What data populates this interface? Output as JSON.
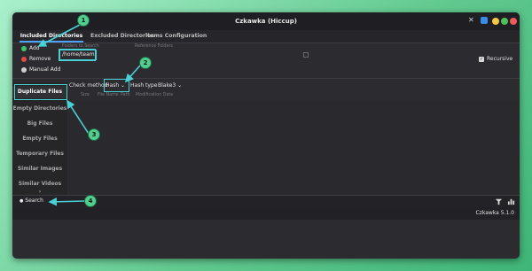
{
  "window": {
    "title": "Czkawka (Hiccup)"
  },
  "tabs": [
    {
      "label": "Included Directories",
      "active": true
    },
    {
      "label": "Excluded Directories",
      "active": false
    },
    {
      "label": "Items Configuration",
      "active": false
    }
  ],
  "included": {
    "actions": [
      {
        "label": "Add",
        "icon": "plus-icon",
        "color": "#3cc46b"
      },
      {
        "label": "Remove",
        "icon": "remove-icon",
        "color": "#e04a4a"
      },
      {
        "label": "Manual Add",
        "icon": "manual-add-icon",
        "color": "#cfcfcf"
      }
    ],
    "columns": {
      "folders": "Folders to Search",
      "reference": "Reference Folders"
    },
    "path": "/home/team",
    "recursive": {
      "label": "Recursive",
      "checked": true
    }
  },
  "sidebar": {
    "items": [
      {
        "label": "Duplicate Files",
        "active": true
      },
      {
        "label": "Empty Directories",
        "active": false
      },
      {
        "label": "Big Files",
        "active": false
      },
      {
        "label": "Empty Files",
        "active": false
      },
      {
        "label": "Temporary Files",
        "active": false
      },
      {
        "label": "Similar Images",
        "active": false
      },
      {
        "label": "Similar Videos",
        "active": false
      }
    ],
    "more": "›"
  },
  "options": {
    "check_method_label": "Check method",
    "check_method_value": "Hash",
    "hash_type_label": "Hash type",
    "hash_type_value": "Blake3"
  },
  "results": {
    "columns": [
      "Size",
      "File Name",
      "Path",
      "Modification Date"
    ]
  },
  "bottom": {
    "search_label": "Search"
  },
  "status": {
    "version": "Czkawka 5.1.0"
  },
  "callouts": [
    "1",
    "2",
    "3",
    "4"
  ],
  "colors": {
    "accent": "#4ad0d4",
    "callout": "#52cf8f",
    "tab_underline": "#4da3ff"
  }
}
